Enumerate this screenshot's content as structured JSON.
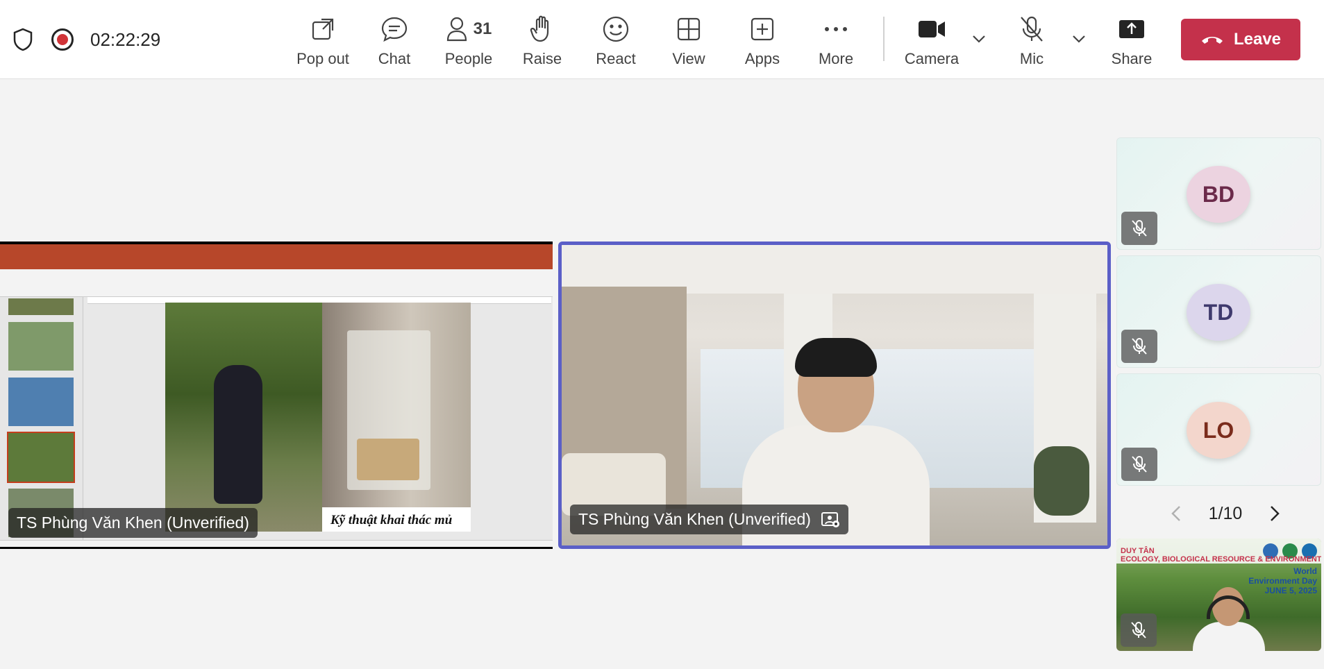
{
  "meeting": {
    "timer": "02:22:29"
  },
  "toolbar": {
    "pop_out": "Pop out",
    "chat": "Chat",
    "people": "People",
    "people_count": "31",
    "raise": "Raise",
    "react": "React",
    "view": "View",
    "apps": "Apps",
    "more": "More",
    "camera": "Camera",
    "mic": "Mic",
    "share": "Share",
    "leave": "Leave"
  },
  "stage": {
    "share_name": "TS Phùng Văn Khen (Unverified)",
    "video_name": "TS Phùng Văn Khen (Unverified)",
    "slide_caption": "Kỹ thuật khai thác mủ"
  },
  "rail": {
    "participants": [
      {
        "initials": "BD",
        "bg": "#ecd3e0",
        "fg": "#6b2a4a"
      },
      {
        "initials": "TD",
        "bg": "#dcd6ec",
        "fg": "#3f3a6d"
      },
      {
        "initials": "LO",
        "bg": "#f3d6cc",
        "fg": "#7a2c1c"
      }
    ],
    "pager": "1/10"
  },
  "self_view": {
    "logo": "DUY TÂN",
    "banner": "ECOLOGY, BIOLOGICAL RESOURCE & ENVIRONMENT",
    "event": "World Environment Day",
    "date": "JUNE 5, 2025"
  },
  "colors": {
    "leave": "#c4314b",
    "active_border": "#5b5fc7",
    "record": "#d13438"
  }
}
